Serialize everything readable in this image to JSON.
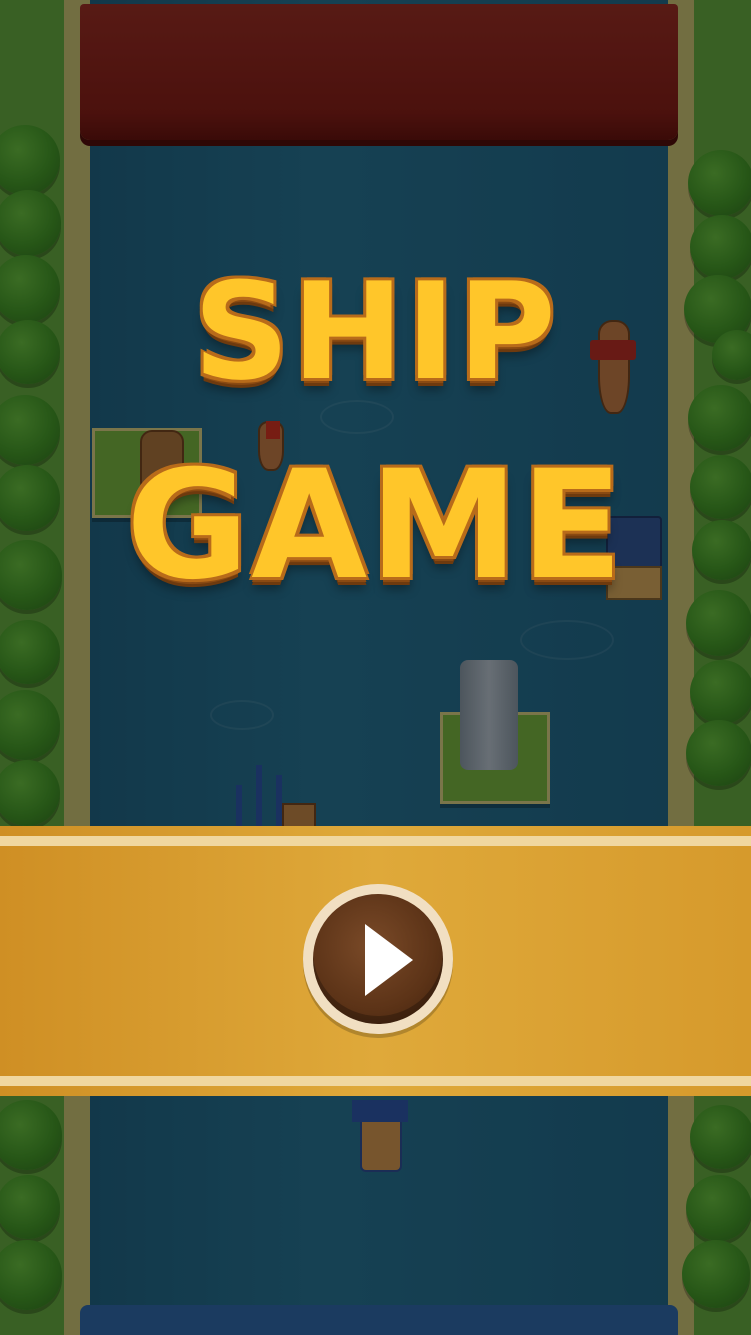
{
  "game": {
    "title_line1": "SHIP",
    "title_line2": "GAME"
  },
  "controls": {
    "play_icon": "play-icon"
  },
  "colors": {
    "title": "#ffc62a",
    "banner": "#dfa93a",
    "play_button": "#5c3317"
  }
}
